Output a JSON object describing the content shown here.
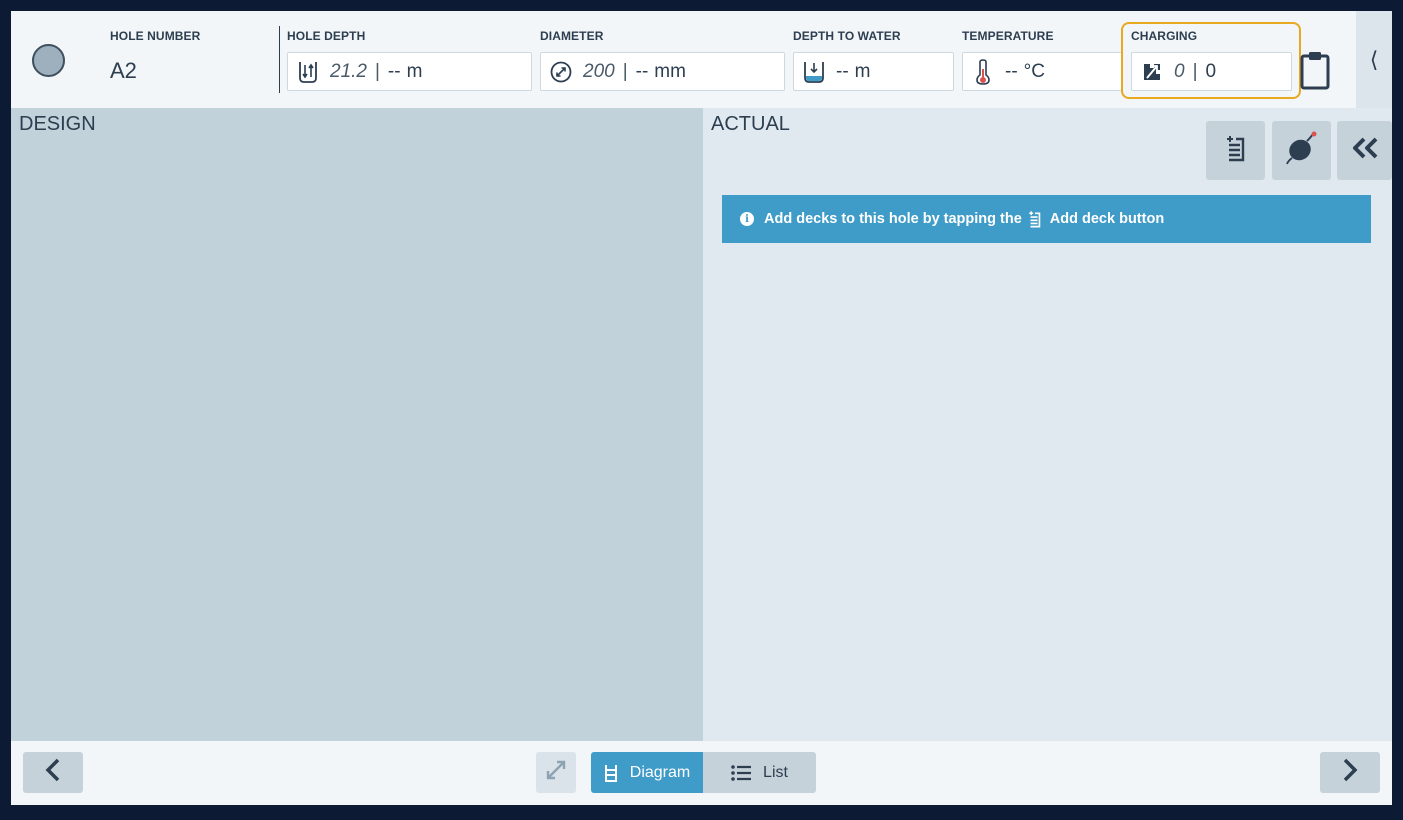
{
  "header": {
    "hole_number": {
      "label": "HOLE NUMBER",
      "value": "A2"
    },
    "hole_depth": {
      "label": "HOLE DEPTH",
      "planned": "21.2",
      "actual": "--",
      "unit": "m",
      "icon": "hole-depth-icon"
    },
    "diameter": {
      "label": "DIAMETER",
      "planned": "200",
      "actual": "--",
      "unit": "mm",
      "icon": "diameter-icon"
    },
    "depth_to_water": {
      "label": "DEPTH TO WATER",
      "value": "--",
      "unit": "m",
      "icon": "water-depth-icon"
    },
    "temperature": {
      "label": "TEMPERATURE",
      "value": "--",
      "unit": "°C",
      "icon": "thermometer-icon"
    },
    "charging": {
      "label": "CHARGING",
      "planned": "0",
      "actual": "0",
      "icon": "charging-icon",
      "highlight_color": "#e8a81f"
    },
    "side_tab_glyph": "⟨"
  },
  "design": {
    "title": "DESIGN"
  },
  "actual": {
    "title": "ACTUAL",
    "info_text_before": "Add decks to this hole by tapping the",
    "info_text_after": "Add deck button",
    "info_color": "#3f9bc8"
  },
  "footer": {
    "view_tabs": [
      {
        "label": "Diagram",
        "active": true,
        "icon": "diagram-icon"
      },
      {
        "label": "List",
        "active": false,
        "icon": "list-icon"
      }
    ]
  },
  "colors": {
    "design_bg": "#c2d2da",
    "actual_bg": "#e1e9f0",
    "accent": "#3f9bc8",
    "text": "#2c3e50"
  }
}
